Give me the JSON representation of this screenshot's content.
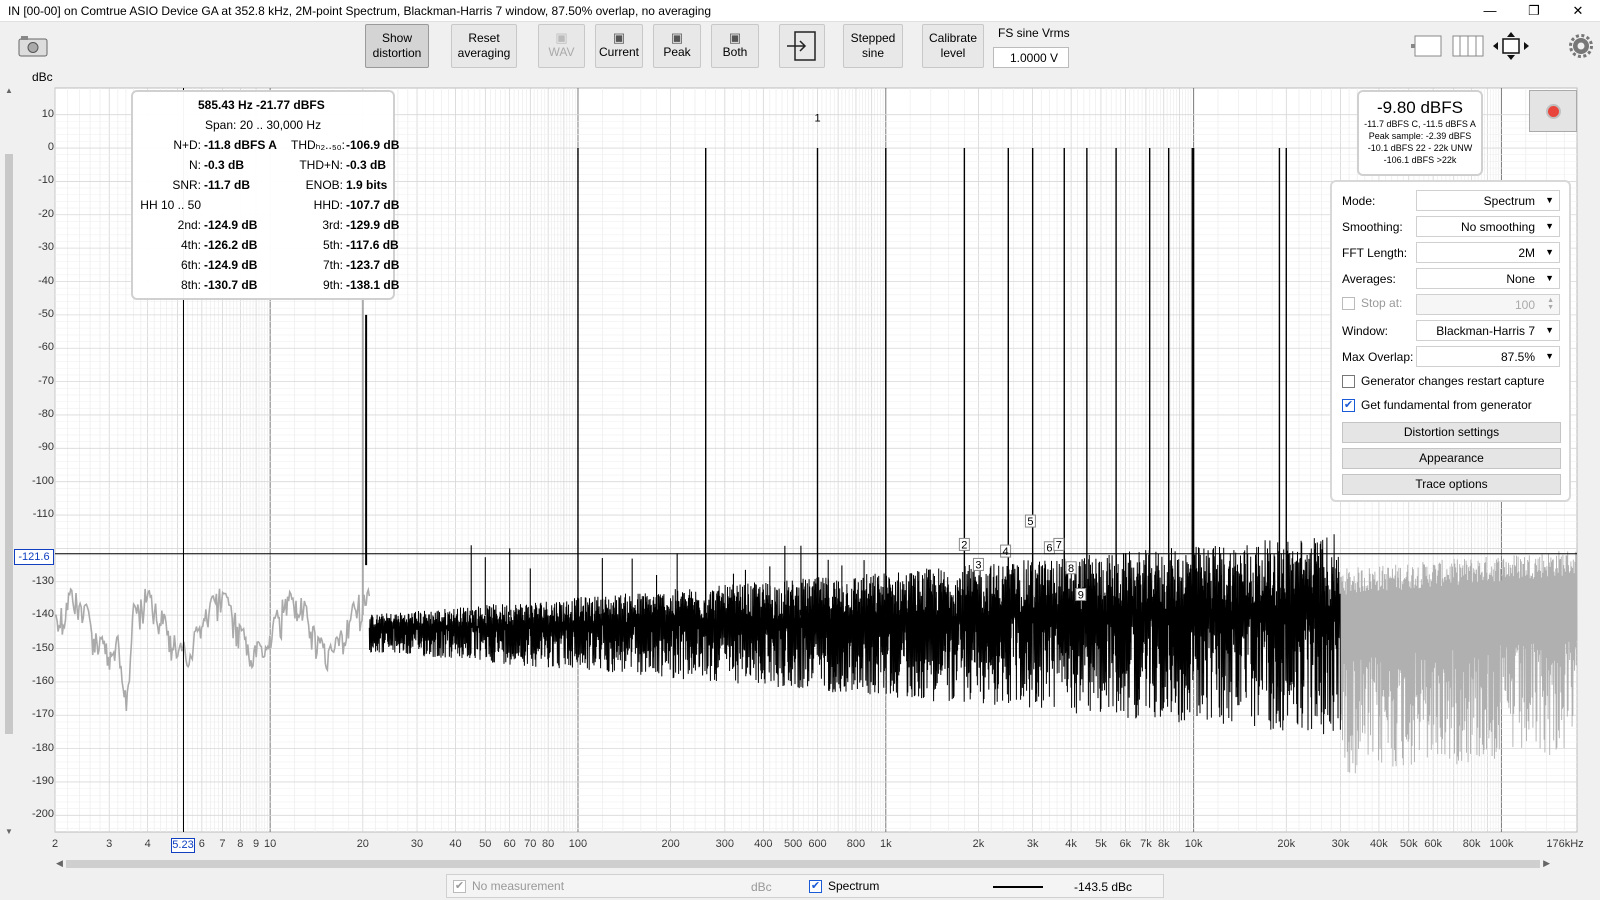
{
  "window": {
    "title": "IN [00-00] on Comtrue ASIO Device GA at 352.8 kHz, 2M-point Spectrum, Blackman-Harris 7 window, 87.50% overlap, no averaging",
    "minimize_glyph": "—",
    "maximize_glyph": "❐",
    "close_glyph": "✕"
  },
  "toolbar": {
    "show_distortion": [
      "Show",
      "distortion"
    ],
    "reset_averaging": [
      "Reset",
      "averaging"
    ],
    "wav": "WAV",
    "current": "Current",
    "peak": "Peak",
    "both": "Both",
    "stepped_sine": [
      "Stepped",
      "sine"
    ],
    "calibrate_level": [
      "Calibrate",
      "level"
    ],
    "fs_sine_label": "FS sine Vrms",
    "fs_sine_value": "1.0000 V",
    "icons": [
      "camera-icon",
      "save-icon",
      "export-icon",
      "single-view-icon",
      "multi-view-icon",
      "pan-zoom-icon",
      "gear-icon"
    ]
  },
  "axis": {
    "y_unit": "dBc",
    "y_ticks": [
      "10",
      "0",
      "-10",
      "-20",
      "-30",
      "-40",
      "-50",
      "-60",
      "-70",
      "-80",
      "-90",
      "-100",
      "-110",
      "-130",
      "-140",
      "-150",
      "-160",
      "-170",
      "-180",
      "-190",
      "-200"
    ],
    "x_ticks": [
      "2",
      "3",
      "4",
      "6",
      "7",
      "8",
      "9",
      "10",
      "20",
      "30",
      "40",
      "50",
      "60",
      "70",
      "80",
      "100",
      "200",
      "300",
      "400",
      "500",
      "600",
      "800",
      "1k",
      "2k",
      "3k",
      "4k",
      "5k",
      "6k",
      "7k",
      "8k",
      "10k",
      "20k",
      "30k",
      "40k",
      "50k",
      "60k",
      "80k",
      "100k",
      "176kHz"
    ],
    "cursor_y": "-121.6",
    "cursor_x": "5.23"
  },
  "chart_data": {
    "type": "line",
    "x_scale": "log",
    "xlim": [
      2,
      176000
    ],
    "ylim": [
      -205,
      18
    ],
    "grid": true,
    "ylabel": "dBc",
    "fundamental_hz": 585.43,
    "tone_peaks_hz": [
      100,
      260,
      600,
      1000,
      1800,
      2500,
      3000,
      3800,
      4500,
      5600,
      7200,
      8300,
      9900,
      10000,
      19000,
      20000
    ],
    "tone_peak_db": 0,
    "noise_floor_db": [
      -140,
      -150
    ],
    "harmonic_markers": [
      "1",
      "2",
      "3",
      "4",
      "5",
      "6",
      "7",
      "8",
      "9"
    ],
    "cursor": {
      "freq_hz": 5.23,
      "level_db": -121.6
    }
  },
  "stats": {
    "header1": "585.43 Hz   -21.77 dBFS",
    "header2": "Span: 20 .. 30,000 Hz",
    "rows": [
      {
        "l1": "N+D:",
        "v1": "-11.8 dBFS A",
        "l2": "THDₕ₂..₅₀:",
        "v2": "-106.9 dB"
      },
      {
        "l1": "N:",
        "v1": "-0.3 dB",
        "l2": "THD+N:",
        "v2": "-0.3 dB"
      },
      {
        "l1": "SNR:",
        "v1": "-11.7 dB",
        "l2": "ENOB:",
        "v2": "1.9 bits"
      },
      {
        "l1": "HH 10 .. 50",
        "v1": "",
        "l2": "HHD:",
        "v2": "-107.7 dB"
      },
      {
        "l1": "2nd:",
        "v1": "-124.9 dB",
        "l2": "3rd:",
        "v2": "-129.9 dB"
      },
      {
        "l1": "4th:",
        "v1": "-126.2 dB",
        "l2": "5th:",
        "v2": "-117.6 dB"
      },
      {
        "l1": "6th:",
        "v1": "-124.9 dB",
        "l2": "7th:",
        "v2": "-123.7 dB"
      },
      {
        "l1": "8th:",
        "v1": "-130.7 dB",
        "l2": "9th:",
        "v2": "-138.1 dB"
      }
    ]
  },
  "level": {
    "main": "-9.80 dBFS",
    "lines": [
      "-11.7 dBFS C, -11.5 dBFS A",
      "Peak sample: -2.39 dBFS",
      "-10.1 dBFS 22 - 22k UNW",
      "-106.1 dBFS >22k"
    ]
  },
  "panel": {
    "mode_label": "Mode:",
    "mode_value": "Spectrum",
    "smoothing_label": "Smoothing:",
    "smoothing_value": "No smoothing",
    "fft_label": "FFT Length:",
    "fft_value": "2M",
    "averages_label": "Averages:",
    "averages_value": "None",
    "stop_label": "Stop at:",
    "stop_value": "100",
    "window_label": "Window:",
    "window_value": "Blackman-Harris 7",
    "overlap_label": "Max Overlap:",
    "overlap_value": "87.5%",
    "gen_restart": "Generator changes restart capture",
    "get_fundamental": "Get fundamental from generator",
    "distortion_settings": "Distortion settings",
    "appearance": "Appearance",
    "trace_options": "Trace options"
  },
  "status": {
    "no_measurement": "No measurement",
    "unit": "dBc",
    "spectrum": "Spectrum",
    "value": "-143.5 dBc"
  }
}
